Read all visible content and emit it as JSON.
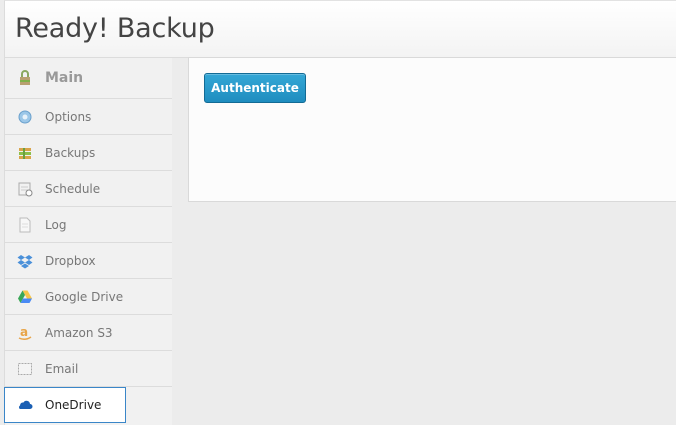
{
  "app": {
    "title": "Ready! Backup"
  },
  "sidebar": {
    "items": [
      {
        "label": "Main",
        "icon": "main-icon"
      },
      {
        "label": "Options",
        "icon": "options-icon"
      },
      {
        "label": "Backups",
        "icon": "backups-icon"
      },
      {
        "label": "Schedule",
        "icon": "schedule-icon"
      },
      {
        "label": "Log",
        "icon": "log-icon"
      },
      {
        "label": "Dropbox",
        "icon": "dropbox-icon"
      },
      {
        "label": "Google Drive",
        "icon": "google-drive-icon"
      },
      {
        "label": "Amazon S3",
        "icon": "amazon-s3-icon"
      },
      {
        "label": "Email",
        "icon": "email-icon"
      },
      {
        "label": "OneDrive",
        "icon": "onedrive-icon"
      }
    ],
    "active": "OneDrive"
  },
  "content": {
    "authenticate_label": "Authenticate"
  },
  "colors": {
    "accent": "#2596c9",
    "active_border": "#3a86c8"
  }
}
